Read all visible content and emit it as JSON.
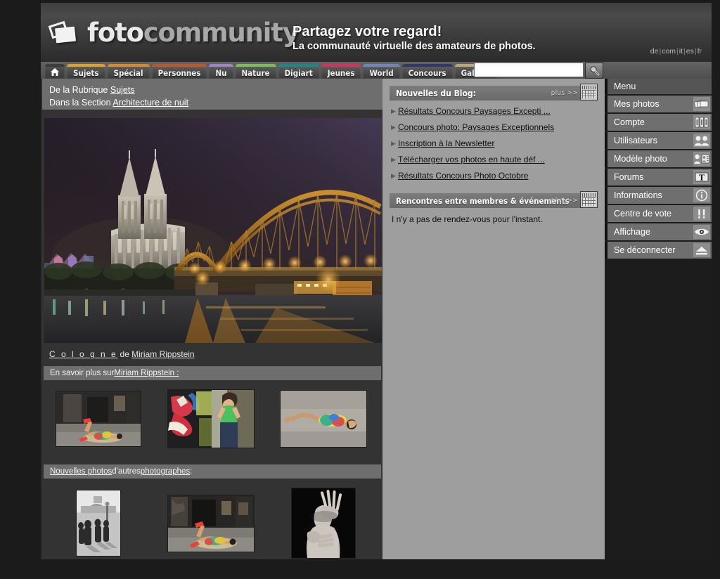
{
  "site": {
    "logo_part1": "foto",
    "logo_part2": "community",
    "tagline_line1": "Partagez votre regard!",
    "tagline_line2": "La communauté virtuelle des amateurs de photos."
  },
  "languages": [
    {
      "code": "de"
    },
    {
      "code": "com"
    },
    {
      "code": "it"
    },
    {
      "code": "es"
    },
    {
      "code": "fr"
    }
  ],
  "search": {
    "value": "",
    "placeholder": "",
    "button_icon": "search-icon"
  },
  "tabs": [
    {
      "label": "",
      "icon": "home-icon",
      "color": "#4e4e4e",
      "home": true
    },
    {
      "label": "Sujets",
      "color": "#e0a129"
    },
    {
      "label": "Spécial",
      "color": "#d9882a"
    },
    {
      "label": "Personnes",
      "color": "#c0572c"
    },
    {
      "label": "Nu",
      "color": "#9f83c6"
    },
    {
      "label": "Nature",
      "color": "#7bbf5a"
    },
    {
      "label": "Digiart",
      "color": "#17898c"
    },
    {
      "label": "Jeunes",
      "color": "#d8315a"
    },
    {
      "label": "World",
      "color": "#6f87bb"
    },
    {
      "label": "Concours",
      "color": "#2e3a66"
    },
    {
      "label": "Galerie",
      "color": "#bca876"
    }
  ],
  "breadcrumb": {
    "line1_prefix": "De la Rubrique ",
    "line1_link": "Sujets",
    "line2_prefix": "Dans la Section ",
    "line2_link": "Architecture de nuit"
  },
  "hero": {
    "alt": "Cologne cathedral and Hohenzollern bridge at night",
    "caption_title": "C o l o g n e",
    "caption_mid": " de ",
    "caption_author": "Miriam Rippstein"
  },
  "author_section": {
    "prefix": "En savoir plus sur ",
    "link": "Miriam Rippstein :"
  },
  "author_thumbs": [
    {
      "name": "woman-lying-warehouse",
      "width": 120,
      "height": 78
    },
    {
      "name": "woman-graffiti-wall",
      "width": 122,
      "height": 82
    },
    {
      "name": "woman-lying-concrete",
      "width": 122,
      "height": 80
    }
  ],
  "others_section": {
    "link1": "Nouvelles photos",
    "mid": " d'autres ",
    "link2": "photographes",
    "suffix": ":"
  },
  "other_thumbs": [
    {
      "name": "paris-bridge-bw",
      "width": 62,
      "height": 93
    },
    {
      "name": "woman-lying-warehouse-2",
      "width": 122,
      "height": 80
    },
    {
      "name": "nude-hands-bw",
      "width": 90,
      "height": 99
    }
  ],
  "blog_panel": {
    "title": "Nouvelles du Blog:",
    "more": "plus >>",
    "icon": "calendar-icon",
    "items": [
      {
        "label": "Résultats Concours Paysages Excepti ..."
      },
      {
        "label": "Concours photo: Paysages Exceptionnels"
      },
      {
        "label": "Inscription à la Newsletter"
      },
      {
        "label": "Télécharger vos photos en haute déf ..."
      },
      {
        "label": "Résultats Concours Photo Octobre"
      }
    ]
  },
  "events_panel": {
    "title": "Rencontres entre membres & événements",
    "more": "plus >>",
    "icon": "calendar-icon",
    "body": "I n'y a pas de rendez-vous pour l'instant."
  },
  "menu": {
    "title": "Menu",
    "items": [
      {
        "label": "Mes photos",
        "icon": "photos-stack-icon"
      },
      {
        "label": "Compte",
        "icon": "binders-icon"
      },
      {
        "label": "Utilisateurs",
        "icon": "users-icon"
      },
      {
        "label": "Modèle photo",
        "icon": "id-card-icon"
      },
      {
        "label": "Forums",
        "icon": "text-t-icon"
      },
      {
        "label": "Informations",
        "icon": "info-circle-icon"
      },
      {
        "label": "Centre de vote",
        "icon": "double-exclamation-icon"
      },
      {
        "label": "Affichage",
        "icon": "eye-icon"
      },
      {
        "label": "Se déconnecter",
        "icon": "eject-icon"
      }
    ]
  },
  "colors": {
    "page_bg": "#1b1b1b",
    "panel_bg": "#9e9e9e",
    "main_bg": "#333333",
    "menu_bg": "#6f6f6f",
    "bar_gray": "#6e6e6e"
  }
}
